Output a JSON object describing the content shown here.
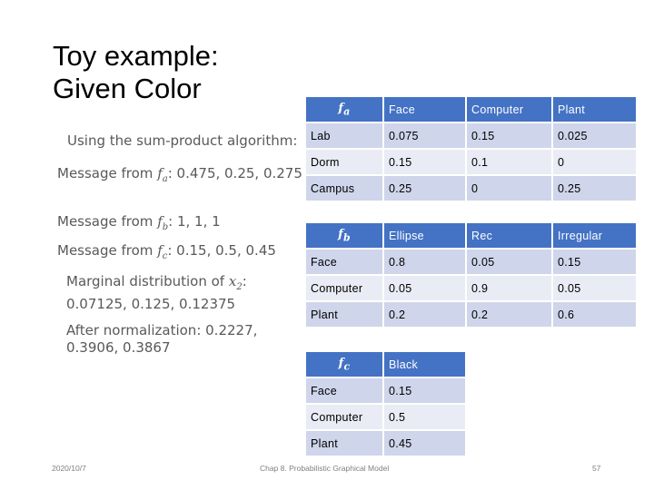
{
  "slide": {
    "title_line1": "Toy example:",
    "title_line2": "Given Color",
    "body": {
      "intro": "Using the sum-product algorithm:",
      "msg_a_prefix": "Message from ",
      "msg_a_symbol": "f",
      "msg_a_sub": "a",
      "msg_a_values": ": 0.475, 0.25, 0.275",
      "msg_b_prefix": "Message from ",
      "msg_b_symbol": "f",
      "msg_b_sub": "b",
      "msg_b_values": ": 1, 1, 1",
      "msg_c_prefix": "Message from ",
      "msg_c_symbol": "f",
      "msg_c_sub": "c",
      "msg_c_values": ": 0.15, 0.5, 0.45",
      "marginal_prefix": "Marginal distribution of ",
      "marginal_symbol": "x",
      "marginal_sub": "2",
      "marginal_values": ": 0.07125, 0.125, 0.12375",
      "normalized": "After normalization: 0.2227, 0.3906, 0.3867"
    },
    "tables": {
      "fa": {
        "header": [
          "f",
          "Face",
          "Computer",
          "Plant"
        ],
        "header_sub": "a",
        "rows": [
          [
            "Lab",
            "0.075",
            "0.15",
            "0.025"
          ],
          [
            "Dorm",
            "0.15",
            "0.1",
            "0"
          ],
          [
            "Campus",
            "0.25",
            "0",
            "0.25"
          ]
        ]
      },
      "fb": {
        "header": [
          "f",
          "Ellipse",
          "Rec",
          "Irregular"
        ],
        "header_sub": "b",
        "rows": [
          [
            "Face",
            "0.8",
            "0.05",
            "0.15"
          ],
          [
            "Computer",
            "0.05",
            "0.9",
            "0.05"
          ],
          [
            "Plant",
            "0.2",
            "0.2",
            "0.6"
          ]
        ]
      },
      "fc": {
        "header": [
          "f",
          "Black"
        ],
        "header_sub": "c",
        "rows": [
          [
            "Face",
            "0.15"
          ],
          [
            "Computer",
            "0.5"
          ],
          [
            "Plant",
            "0.45"
          ]
        ]
      }
    },
    "footer": {
      "date": "2020/10/7",
      "chapter": "Chap 8. Probabilistic Graphical Model",
      "page": "57"
    },
    "colors": {
      "header_blue": "#4472c4",
      "row_dark": "#cfd5ea",
      "row_light": "#e9ebf5"
    }
  }
}
